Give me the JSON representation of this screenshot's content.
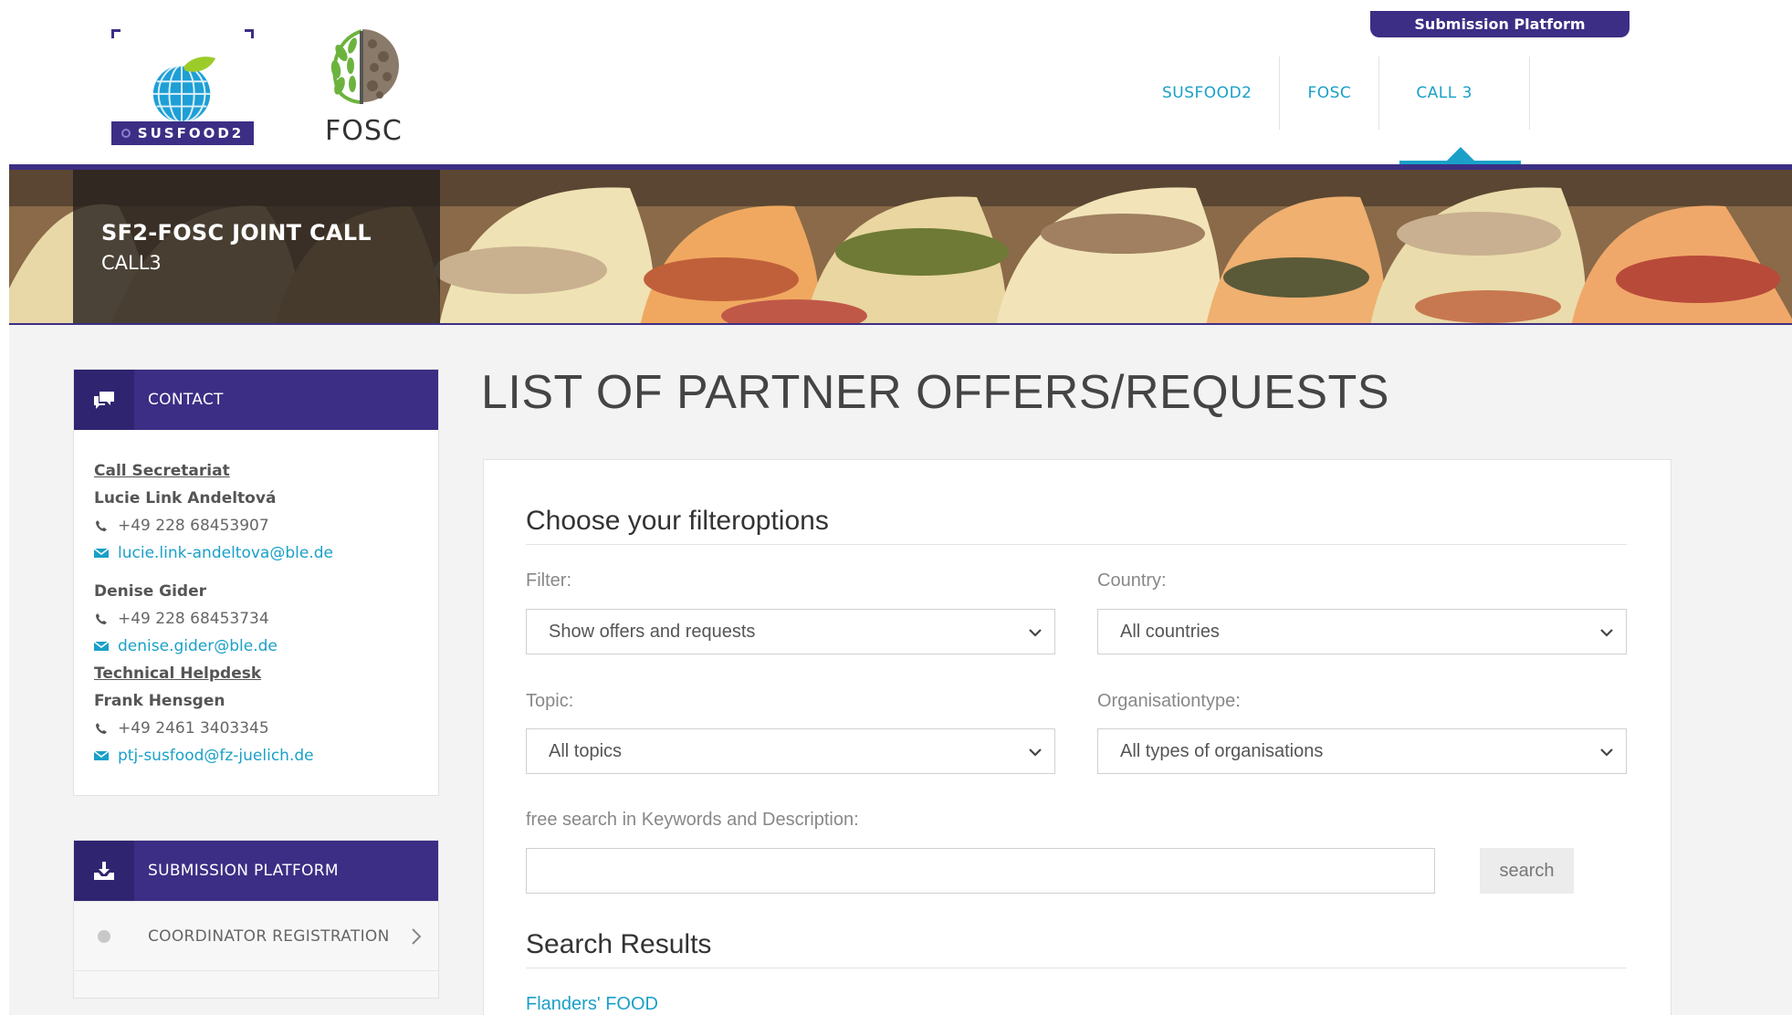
{
  "header": {
    "logo_susfood_text": "SUSFOOD2",
    "logo_fosc_text": "FOSC",
    "submission_tab": "Submission Platform",
    "nav": [
      {
        "label": "SUSFOOD2"
      },
      {
        "label": "FOSC"
      },
      {
        "label": "CALL 3",
        "active": true
      }
    ],
    "brand_color": "#3c2e84",
    "accent_color": "#1aa0c8"
  },
  "banner": {
    "title": "SF2-FOSC JOINT CALL",
    "subtitle": "CALL3"
  },
  "sidebar": {
    "contact": {
      "heading": "CONTACT",
      "icon": "chat-bubbles-icon",
      "call_secretariat_title": "Call Secretariat",
      "persons": [
        {
          "name": "Lucie Link Andeltová",
          "phone": "+49 228 68453907",
          "email": "lucie.link-andeltova@ble.de"
        },
        {
          "name": "Denise Gider",
          "phone": "+49 228 68453734",
          "email": "denise.gider@ble.de"
        }
      ],
      "helpdesk_title": "Technical Helpdesk",
      "helpdesk": {
        "name": "Frank Hensgen",
        "phone": "+49 2461 3403345",
        "email": "ptj-susfood@fz-juelich.de"
      }
    },
    "submission": {
      "heading": "SUBMISSION PLATFORM",
      "icon": "download-tray-icon",
      "items": [
        {
          "label": "COORDINATOR REGISTRATION"
        }
      ]
    }
  },
  "main": {
    "title": "LIST OF PARTNER OFFERS/REQUESTS",
    "filter_heading": "Choose your filteroptions",
    "filter_label": "Filter:",
    "filter_value": "Show offers and requests",
    "country_label": "Country:",
    "country_value": "All countries",
    "topic_label": "Topic:",
    "topic_value": "All topics",
    "orgtype_label": "Organisationtype:",
    "orgtype_value": "All types of organisations",
    "free_search_label": "free search in Keywords and Description:",
    "free_search_value": "",
    "search_button": "search",
    "results_heading": "Search Results",
    "results": [
      {
        "title": "Flanders' FOOD"
      }
    ]
  }
}
